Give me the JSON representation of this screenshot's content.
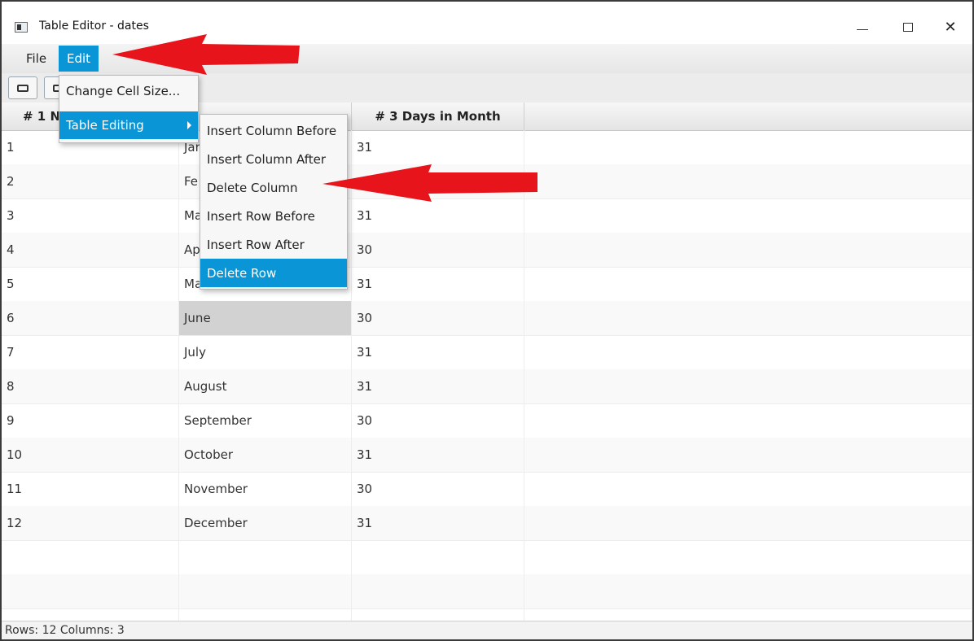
{
  "window": {
    "title": "Table Editor - dates",
    "minimize_icon": "minimize-icon",
    "maximize_icon": "maximize-icon",
    "close_icon": "close-icon",
    "close_glyph": "✕"
  },
  "menubar": {
    "items": [
      {
        "label": "File"
      },
      {
        "label": "Edit"
      }
    ]
  },
  "edit_menu": {
    "items": [
      {
        "label": "Change Cell Size..."
      },
      {
        "label": "Table Editing"
      }
    ]
  },
  "table_editing_submenu": {
    "items": [
      {
        "label": "Insert Column Before"
      },
      {
        "label": "Insert Column After"
      },
      {
        "label": "Delete Column"
      },
      {
        "label": "Insert Row Before"
      },
      {
        "label": "Insert Row After"
      },
      {
        "label": "Delete Row"
      }
    ],
    "highlighted": "Delete Row"
  },
  "table": {
    "headers": [
      "# 1 N",
      "",
      "# 3 Days in Month"
    ],
    "rows": [
      [
        "1",
        "Jan",
        "31"
      ],
      [
        "2",
        "Fe",
        ""
      ],
      [
        "3",
        "Ma",
        "31"
      ],
      [
        "4",
        "Ap",
        "30"
      ],
      [
        "5",
        "Ma",
        "31"
      ],
      [
        "6",
        "June",
        "30"
      ],
      [
        "7",
        "July",
        "31"
      ],
      [
        "8",
        "August",
        "31"
      ],
      [
        "9",
        "September",
        "30"
      ],
      [
        "10",
        "October",
        "31"
      ],
      [
        "11",
        "November",
        "30"
      ],
      [
        "12",
        "December",
        "31"
      ],
      [
        "",
        "",
        ""
      ],
      [
        "",
        "",
        ""
      ],
      [
        "",
        "",
        ""
      ]
    ],
    "selected_cell": "June"
  },
  "statusbar": {
    "text": "Rows: 12   Columns: 3"
  },
  "colors": {
    "accent": "#0a96d6",
    "arrow": "#e8141b"
  }
}
